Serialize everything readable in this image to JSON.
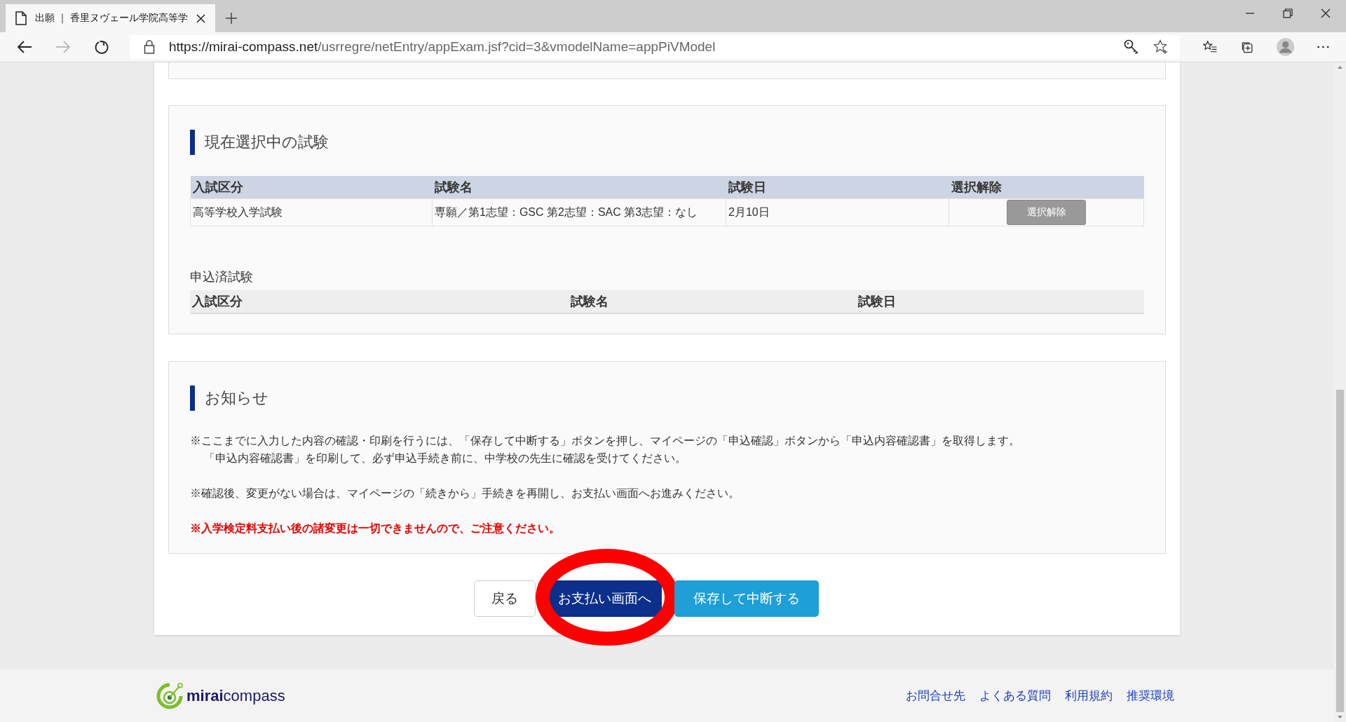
{
  "browser": {
    "tabs": [
      {
        "title": "出願 ｜ 香里ヌヴェール学院高等学",
        "selected": true
      }
    ],
    "nav": [
      {
        "kind": "back",
        "disabled": false
      },
      {
        "kind": "forward",
        "disabled": true
      },
      {
        "kind": "refresh",
        "disabled": false
      }
    ],
    "url_host": "https://mirai-compass.net",
    "url_path": "/usrregre/netEntry/appExam.jsf?cid=3&vmodelName=appPiVModel"
  },
  "current_exams": {
    "title": "現在選択中の試験",
    "columns": [
      "入試区分",
      "試験名",
      "試験日",
      "選択解除"
    ],
    "rows": [
      {
        "category": "高等学校入学試験",
        "exam_name": "専願／第1志望：GSC 第2志望：SAC 第3志望：なし",
        "date": "2月10日",
        "button": "選択解除"
      }
    ]
  },
  "applied_exams": {
    "title": "申込済試験",
    "columns": [
      "入試区分",
      "試験名",
      "試験日"
    ]
  },
  "notice": {
    "title": "お知らせ",
    "paragraphs": [
      {
        "kind": "note",
        "lines": [
          "※ここまでに入力した内容の確認・印刷を行うには、「保存して中断する」ボタンを押し、マイページの「申込確認」ボタンから「申込内容確認書」を取得します。",
          "「申込内容確認書」を印刷して、必ず申込手続き前に、中学校の先生に確認を受けてください。"
        ]
      },
      {
        "kind": "note",
        "lines": [
          "※確認後、変更がない場合は、マイページの「続きから」手続きを再開し、お支払い画面へお進みください。"
        ]
      },
      {
        "kind": "warning",
        "lines": [
          "※入学検定料支払い後の諸変更は一切できませんので、ご注意ください。"
        ]
      }
    ]
  },
  "buttons": [
    {
      "label": "戻る",
      "kind": "back",
      "highlighted": false
    },
    {
      "label": "お支払い画面へ",
      "kind": "primary",
      "highlighted": true
    },
    {
      "label": "保存して中断する",
      "kind": "save",
      "highlighted": false
    }
  ],
  "footer": {
    "logo": "**mirai**compass",
    "links": [
      "お問合せ先",
      "よくある質問",
      "利用規約",
      "推奨環境"
    ]
  }
}
